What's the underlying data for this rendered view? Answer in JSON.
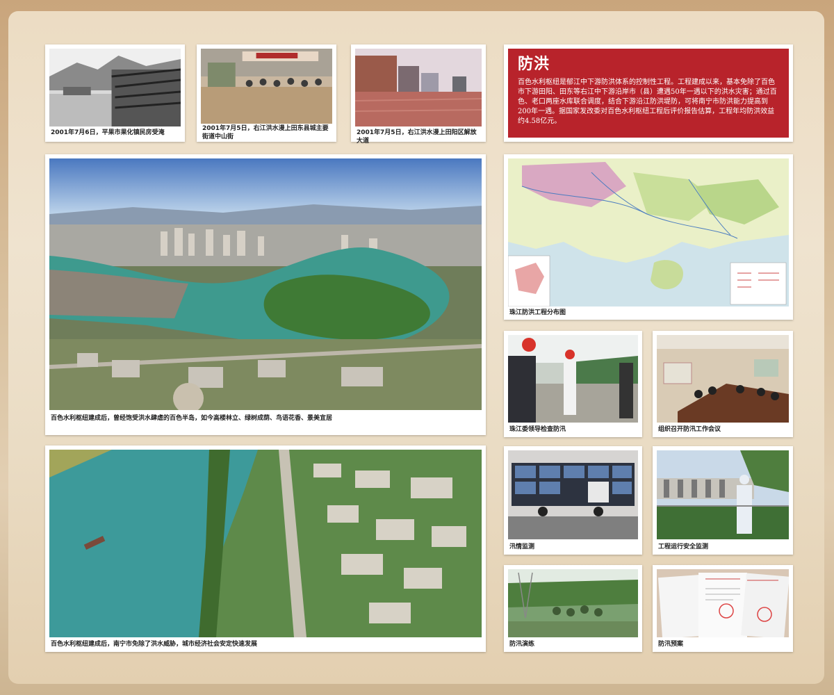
{
  "info": {
    "title": "防洪",
    "body": "百色水利枢纽是郁江中下游防洪体系的控制性工程。工程建成以来，基本免除了百色市下游田阳、田东等右江中下游沿岸市（县）遭遇50年一遇以下的洪水灾害；通过百色、老口两座水库联合调度，结合下游沿江防洪堤防，可将南宁市防洪能力提高到200年一遇。据国家发改委对百色水利枢纽工程后评价报告估算，工程年均防洪效益约4.58亿元。"
  },
  "photos": {
    "p1": "2001年7月6日，平果市果化镇民房受淹",
    "p2": "2001年7月5日，右江洪水漫上田东县城主要街道中山街",
    "p3": "2001年7月5日，右江洪水漫上田阳区解放大道",
    "p4": "百色水利枢纽建成后，曾经饱受洪水肆虐的百色半岛，如今高楼林立、绿树成荫、鸟语花香、景美宜居",
    "p5": "百色水利枢纽建成后，南宁市免除了洪水威胁，城市经济社会安定快速发展",
    "map": "珠江防洪工程分布图",
    "s1": "珠江委领导检查防汛",
    "s2": "组织召开防汛工作会议",
    "s3": "汛情监测",
    "s4": "工程运行安全监测",
    "s5": "防汛演练",
    "s6": "防汛预案"
  },
  "colors": {
    "accent_red": "#b8232b",
    "background": "#e8d6bb"
  }
}
